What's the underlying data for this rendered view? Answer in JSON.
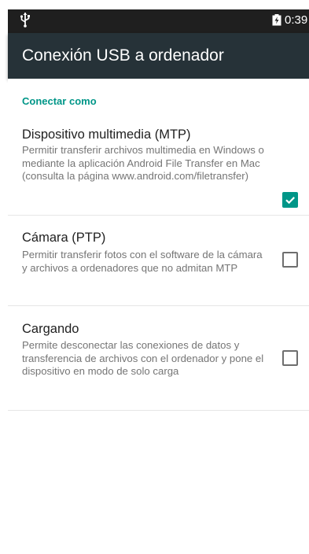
{
  "status_bar": {
    "time": "0:39",
    "left_icon": "usb-icon",
    "battery_icon": "battery-charging-icon"
  },
  "app_bar": {
    "title": "Conexión USB a ordenador"
  },
  "section": {
    "header": "Conectar como"
  },
  "options": [
    {
      "title": "Dispositivo multimedia (MTP)",
      "summary": "Permitir transferir archivos multimedia en Windows o mediante la aplicación Android File Transfer en Mac (consulta la página www.android.com/filetransfer)",
      "checked": true
    },
    {
      "title": "Cámara (PTP)",
      "summary": "Permitir transferir fotos con el software de la cámara y archivos a ordenadores que no admitan MTP",
      "checked": false
    },
    {
      "title": "Cargando",
      "summary": "Permite desconectar las conexiones de datos y transferencia de archivos con el ordenador y pone el dispositivo en modo de solo carga",
      "checked": false
    }
  ],
  "colors": {
    "accent": "#009688",
    "app_bar": "#263238",
    "status_bar": "#1f1f1f"
  }
}
